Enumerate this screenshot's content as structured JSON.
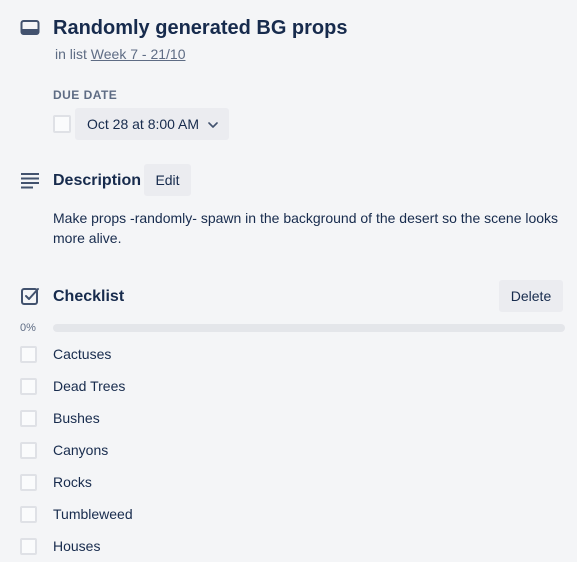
{
  "card": {
    "title": "Randomly generated BG props",
    "in_list_prefix": "in list",
    "list_name": "Week 7 - 21/10"
  },
  "due_date": {
    "label": "DUE DATE",
    "value": "Oct 28 at 8:00 AM",
    "completed": false
  },
  "description": {
    "title": "Description",
    "edit_label": "Edit",
    "text": "Make props -randomly- spawn in the background of the desert so the scene looks more alive."
  },
  "checklist": {
    "title": "Checklist",
    "delete_label": "Delete",
    "progress_label": "0%",
    "progress": 0,
    "items": [
      {
        "label": "Cactuses",
        "checked": false
      },
      {
        "label": "Dead Trees",
        "checked": false
      },
      {
        "label": "Bushes",
        "checked": false
      },
      {
        "label": "Canyons",
        "checked": false
      },
      {
        "label": "Rocks",
        "checked": false
      },
      {
        "label": "Tumbleweed",
        "checked": false
      },
      {
        "label": "Houses",
        "checked": false
      }
    ]
  },
  "icons": {
    "card": "card-icon",
    "description": "description-lines-icon",
    "checklist": "checklist-checkbox-icon",
    "dropdown": "chevron-down-icon"
  }
}
